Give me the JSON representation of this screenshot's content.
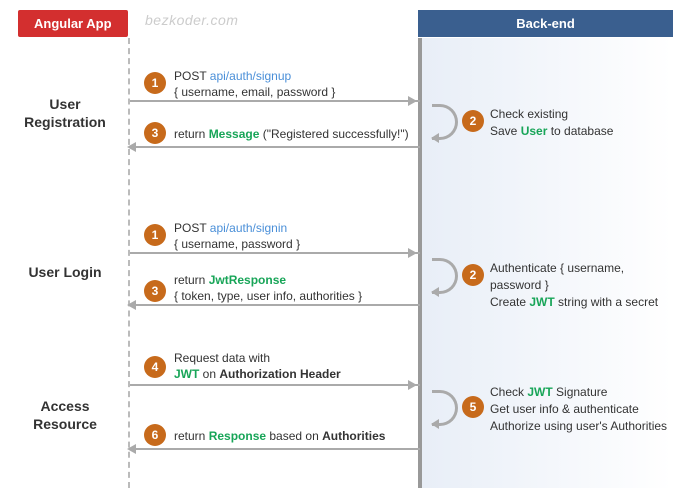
{
  "watermark": "bezkoder.com",
  "headers": {
    "angular": "Angular App",
    "backend": "Back-end"
  },
  "sections": {
    "registration": "User Registration",
    "login": "User Login",
    "access": "Access Resource"
  },
  "badges": {
    "b1": "1",
    "b2": "2",
    "b3": "3",
    "b4": "4",
    "b5": "5",
    "b6": "6"
  },
  "reg": {
    "req_verb": "POST ",
    "req_path": "api/auth/signup",
    "req_body": "{ username, email, password }",
    "be_l1": "Check existing",
    "be_l2a": "Save ",
    "be_l2b": "User",
    "be_l2c": " to database",
    "res_a": "return ",
    "res_b": "Message",
    "res_c": " (\"Registered successfully!\")"
  },
  "login": {
    "req_verb": "POST ",
    "req_path": "api/auth/signin",
    "req_body": "{ username, password }",
    "be_l1": "Authenticate { username, password }",
    "be_l2a": "Create ",
    "be_l2b": "JWT",
    "be_l2c": " string with a secret",
    "res_a": "return ",
    "res_b": "JwtResponse",
    "res_c": "{ token, type, user info, authorities }"
  },
  "access": {
    "req_l1": "Request  data with",
    "req_l2a": "JWT",
    "req_l2b": " on ",
    "req_l2c": "Authorization Header",
    "be_l1a": "Check ",
    "be_l1b": "JWT",
    "be_l1c": " Signature",
    "be_l2": "Get user info & authenticate",
    "be_l3": "Authorize using user's Authorities",
    "res_a": "return ",
    "res_b": "Response",
    "res_c": " based on ",
    "res_d": "Authorities"
  }
}
